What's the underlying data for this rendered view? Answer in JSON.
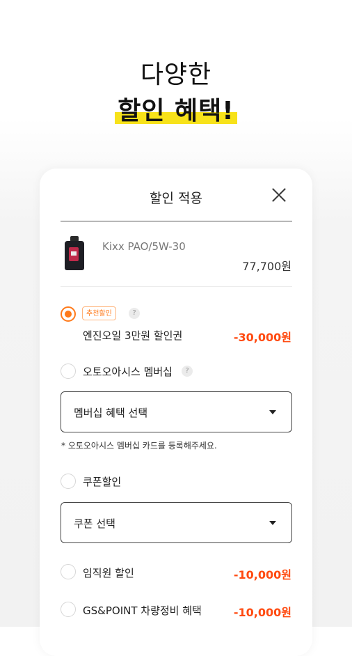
{
  "headline": {
    "line1": "다양한",
    "line2": "할인 혜택!"
  },
  "modal": {
    "title": "할인 적용",
    "product": {
      "name": "Kixx PAO/5W-30",
      "price": "77,700원"
    },
    "recommended": {
      "badge": "추천할인",
      "help": "?",
      "label": "엔진오일 3만원 할인권",
      "amount": "-30,000원",
      "selected": true
    },
    "membership": {
      "label": "오토오아시스 멤버십",
      "help": "?",
      "select_value": "멤버십 혜택 선택",
      "note": "* 오토오아시스 멤버십 카드를 등록해주세요."
    },
    "coupon": {
      "label": "쿠폰할인",
      "select_value": "쿠폰 선택"
    },
    "employee": {
      "label": "임직원 할인",
      "amount": "-10,000원"
    },
    "gspoint": {
      "label": "GS&POINT 차량정비 혜택",
      "amount": "-10,000원"
    }
  },
  "colors": {
    "accent": "#ff7a1a",
    "discount": "#ff4a10",
    "highlight": "#f7e21a"
  }
}
